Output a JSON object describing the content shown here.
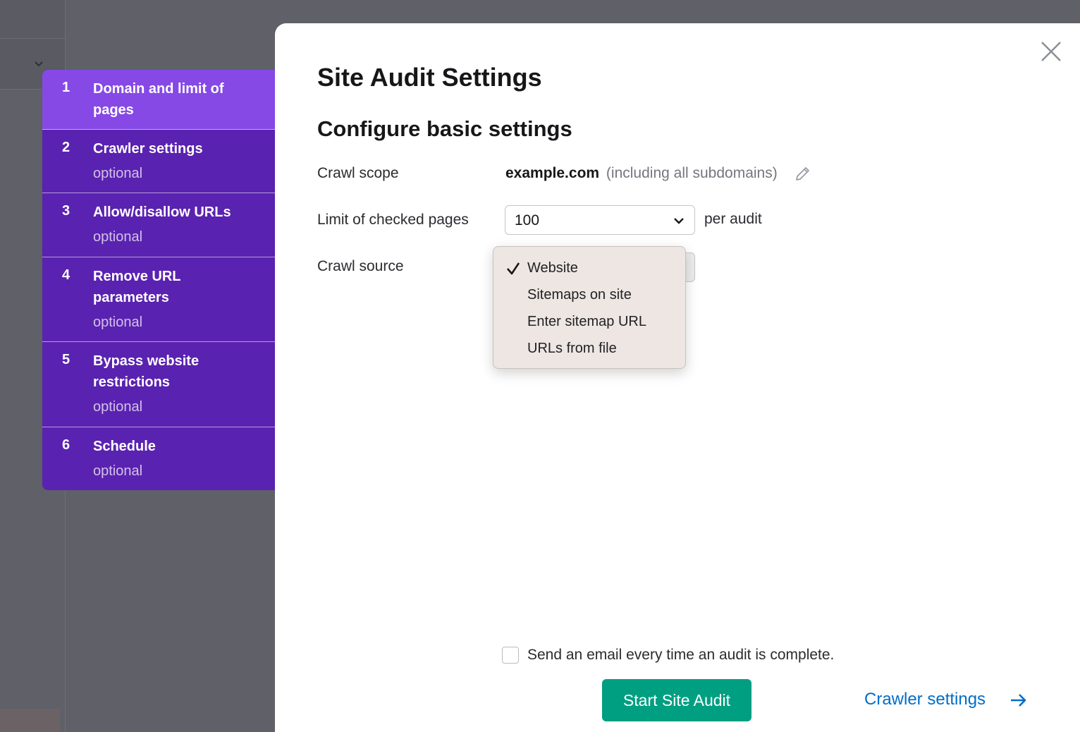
{
  "stepper": {
    "steps": [
      {
        "number": "1",
        "title": "Domain and limit of pages",
        "subtitle": ""
      },
      {
        "number": "2",
        "title": "Crawler settings",
        "subtitle": "optional"
      },
      {
        "number": "3",
        "title": "Allow/disallow URLs",
        "subtitle": "optional"
      },
      {
        "number": "4",
        "title": "Remove URL parameters",
        "subtitle": "optional"
      },
      {
        "number": "5",
        "title": "Bypass website restrictions",
        "subtitle": "optional"
      },
      {
        "number": "6",
        "title": "Schedule",
        "subtitle": "optional"
      }
    ],
    "active_step": "1"
  },
  "modal": {
    "title": "Site Audit Settings",
    "section_title": "Configure basic settings",
    "crawl_scope": {
      "label": "Crawl scope",
      "domain": "example.com",
      "note": "(including all subdomains)"
    },
    "limit": {
      "label": "Limit of checked pages",
      "value": "100",
      "suffix": "per audit"
    },
    "crawl_source": {
      "label": "Crawl source",
      "options": [
        "Website",
        "Sitemaps on site",
        "Enter sitemap URL",
        "URLs from file"
      ],
      "selected": "Website"
    },
    "email_checkbox": {
      "label": "Send an email every time an audit is complete.",
      "checked": false
    },
    "start_button": "Start Site Audit",
    "next_link": "Crawler settings"
  },
  "icons": {
    "close": "close-icon",
    "edit": "pencil-icon",
    "chevron": "chevron-down-icon",
    "check": "checkmark-icon",
    "arrow": "arrow-right-icon"
  },
  "colors": {
    "stepper_bg": "#5a22b0",
    "stepper_active": "#8649e6",
    "primary_button": "#009f81",
    "link": "#006dca"
  }
}
